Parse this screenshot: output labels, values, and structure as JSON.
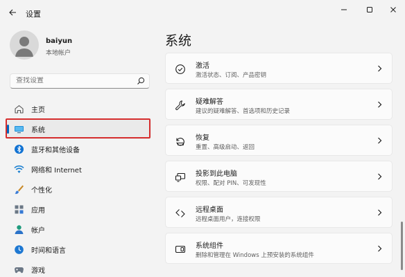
{
  "app": {
    "title": "设置"
  },
  "user": {
    "name": "baiyun",
    "account_type": "本地帐户"
  },
  "search": {
    "placeholder": "查找设置"
  },
  "nav": {
    "items": [
      {
        "label": "主页",
        "icon": "home-icon"
      },
      {
        "label": "系统",
        "icon": "system-icon",
        "selected": true
      },
      {
        "label": "蓝牙和其他设备",
        "icon": "bluetooth-icon"
      },
      {
        "label": "网络和 Internet",
        "icon": "network-icon"
      },
      {
        "label": "个性化",
        "icon": "personalization-icon"
      },
      {
        "label": "应用",
        "icon": "apps-icon"
      },
      {
        "label": "帐户",
        "icon": "account-icon"
      },
      {
        "label": "时间和语言",
        "icon": "time-language-icon"
      },
      {
        "label": "游戏",
        "icon": "gaming-icon"
      }
    ]
  },
  "main": {
    "title": "系统",
    "cards": [
      {
        "title": "激活",
        "desc": "激活状态、订阅、产品密钥",
        "icon": "activation-icon"
      },
      {
        "title": "疑难解答",
        "desc": "建议的疑难解答、首选项和历史记录",
        "icon": "troubleshoot-icon"
      },
      {
        "title": "恢复",
        "desc": "重置、高级启动、返回",
        "icon": "recovery-icon"
      },
      {
        "title": "投影到此电脑",
        "desc": "权限、配对 PIN、可发现性",
        "icon": "projection-icon"
      },
      {
        "title": "远程桌面",
        "desc": "远程桌面用户，连接权限",
        "icon": "remote-desktop-icon"
      },
      {
        "title": "系统组件",
        "desc": "删除和管理在 Windows 上预安装的系统组件",
        "icon": "system-components-icon"
      }
    ]
  },
  "colors": {
    "accent": "#0067c0",
    "highlight_border": "#d62d2d",
    "background": "#f3f3f3",
    "card": "#fbfbfb"
  }
}
